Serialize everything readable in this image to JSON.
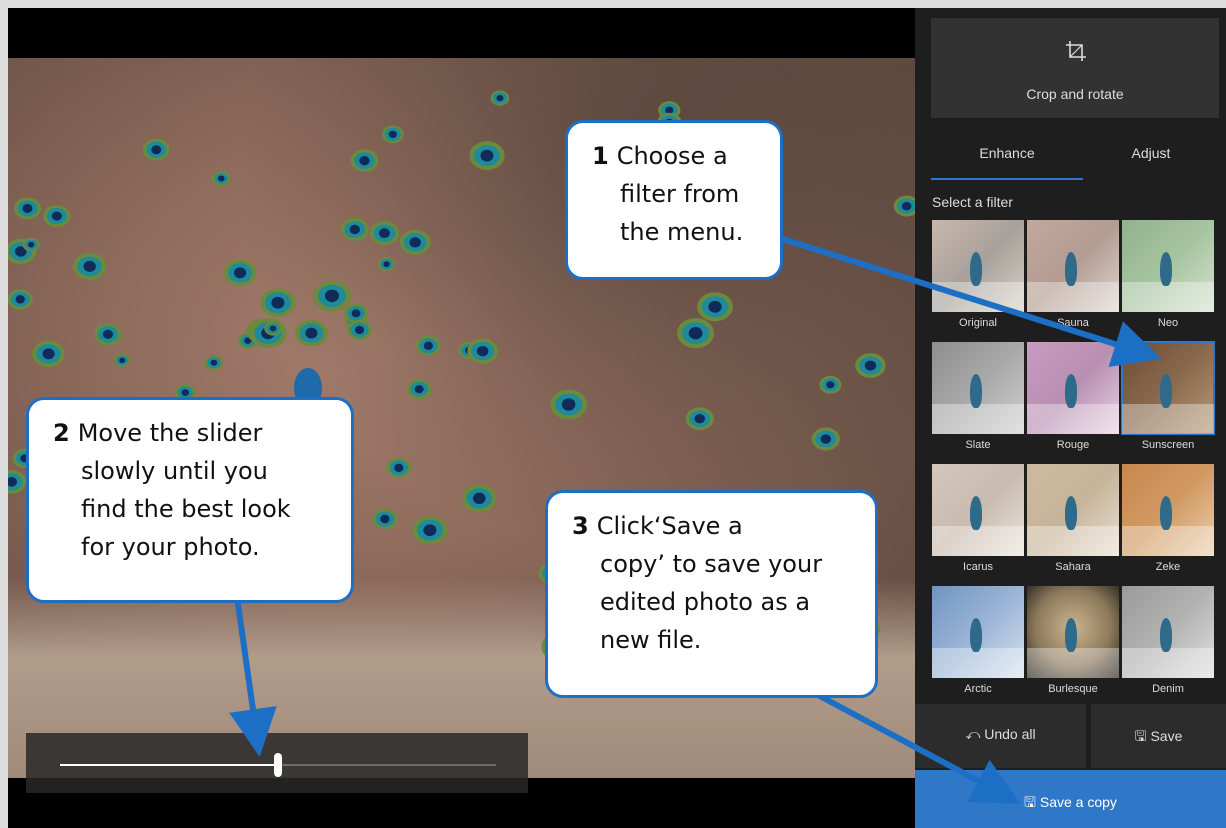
{
  "panel": {
    "crop_label": "Crop and rotate",
    "tabs": [
      {
        "label": "Enhance",
        "active": true
      },
      {
        "label": "Adjust",
        "active": false
      }
    ],
    "filter_title": "Select a filter",
    "filters": [
      {
        "name": "Original"
      },
      {
        "name": "Sauna"
      },
      {
        "name": "Neo"
      },
      {
        "name": "Slate"
      },
      {
        "name": "Rouge"
      },
      {
        "name": "Sunscreen",
        "selected": true
      },
      {
        "name": "Icarus"
      },
      {
        "name": "Sahara"
      },
      {
        "name": "Zeke"
      },
      {
        "name": "Arctic"
      },
      {
        "name": "Burlesque"
      },
      {
        "name": "Denim"
      }
    ],
    "undo_label": "Undo all",
    "save_label": "Save",
    "save_copy_label": "Save a copy"
  },
  "slider": {
    "value_fraction": 0.5
  },
  "callouts": {
    "one": {
      "num": "1",
      "lines": [
        "Choose a",
        "filter from",
        "the menu."
      ]
    },
    "two": {
      "num": "2",
      "lines": [
        "Move the slider",
        "slowly until you",
        "find the best look",
        "for your photo."
      ]
    },
    "three": {
      "num": "3",
      "lines": [
        "Click‘Save a",
        "copy’ to save your",
        "edited photo as a",
        "new file."
      ]
    }
  },
  "colors": {
    "accent": "#2f78c8",
    "callout_border": "#1d6fc6",
    "panel_bg": "#1e1e1e"
  },
  "icons": {
    "crop": "crop-icon",
    "undo": "undo-icon",
    "save": "save-icon"
  }
}
